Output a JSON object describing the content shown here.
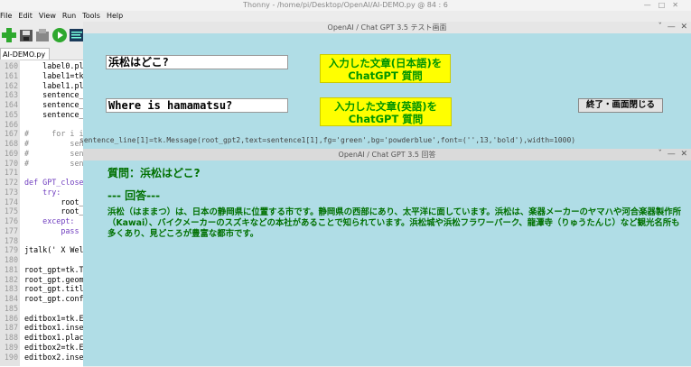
{
  "thonny": {
    "title": "Thonny  -  /home/pi/Desktop/OpenAI/AI-DEMO.py  @  84 : 6",
    "window_controls": [
      "—",
      "□",
      "✕"
    ],
    "menu": [
      "File",
      "Edit",
      "View",
      "Run",
      "Tools",
      "Help"
    ],
    "tab": "AI-DEMO.py",
    "lines": [
      {
        "n": "160",
        "code": "    label0.pla"
      },
      {
        "n": "161",
        "code": "    label1=tk."
      },
      {
        "n": "162",
        "code": "    label1.pla"
      },
      {
        "n": "163",
        "code": "    sentence_b"
      },
      {
        "n": "164",
        "code": "    sentence_b"
      },
      {
        "n": "165",
        "code": "    sentence_b"
      },
      {
        "n": "166",
        "code": ""
      },
      {
        "n": "167",
        "code": "#     for i in"
      },
      {
        "n": "168",
        "code": "#         sent"
      },
      {
        "n": "169",
        "code": "#         sent"
      },
      {
        "n": "170",
        "code": "#         sent"
      },
      {
        "n": "171",
        "code": ""
      },
      {
        "n": "172",
        "code": "def GPT_close("
      },
      {
        "n": "173",
        "code": "    try:"
      },
      {
        "n": "174",
        "code": "        root_g"
      },
      {
        "n": "175",
        "code": "        root_g"
      },
      {
        "n": "176",
        "code": "    except:"
      },
      {
        "n": "177",
        "code": "        pass"
      },
      {
        "n": "178",
        "code": ""
      },
      {
        "n": "179",
        "code": "jtalk(' X Well"
      },
      {
        "n": "180",
        "code": ""
      },
      {
        "n": "181",
        "code": "root_gpt=tk.Tk"
      },
      {
        "n": "182",
        "code": "root_gpt.geome"
      },
      {
        "n": "183",
        "code": "root_gpt.title"
      },
      {
        "n": "184",
        "code": "root_gpt.confi"
      },
      {
        "n": "185",
        "code": ""
      },
      {
        "n": "186",
        "code": "editbox1=tk.En"
      },
      {
        "n": "187",
        "code": "editbox1.inser"
      },
      {
        "n": "188",
        "code": "editbox1.place"
      },
      {
        "n": "189",
        "code": "editbox2=tk.En"
      },
      {
        "n": "190",
        "code": "editbox2.inser"
      }
    ],
    "overflow_code": "sentence_line[1]=tk.Message(root_gpt2,text=sentence1[1],fg='green',bg='powderblue',font=('',13,'bold'),width=1000)"
  },
  "window1": {
    "title": "OpenAI / Chat GPT 3.5 テスト画面",
    "controls": [
      "ˇ",
      "—",
      "✕"
    ],
    "entry_japanese": "浜松はどこ?",
    "entry_english": "Where is hamamatsu?",
    "button_japanese": {
      "line1": "入力した文章(日本語)を",
      "line2": "ChatGPT 質問"
    },
    "button_english": {
      "line1": "入力した文章(英語)を",
      "line2": "ChatGPT 質問"
    },
    "close_button": "終了・画面閉じる"
  },
  "window2": {
    "title": "OpenAI / Chat GPT 3.5 回答",
    "controls": [
      "ˇ",
      "—",
      "✕"
    ],
    "question": "質問：浜松はどこ?",
    "answer_header": "--- 回答---",
    "answer": "浜松（はままつ）は、日本の静岡県に位置する市です。静岡県の西部にあり、太平洋に面しています。浜松は、楽器メーカーのヤマハや河合楽器製作所（Kawai）、バイクメーカーのスズキなどの本社があることで知られています。浜松城や浜松フラワーパーク、龍潭寺（りゅうたんじ）など観光名所も多くあり、見どころが豊富な都市です。"
  },
  "colors": {
    "window_bg": "#b0dde6",
    "answer_text": "#007000",
    "button_bg": "#ffff00",
    "button_text": "#009500"
  }
}
